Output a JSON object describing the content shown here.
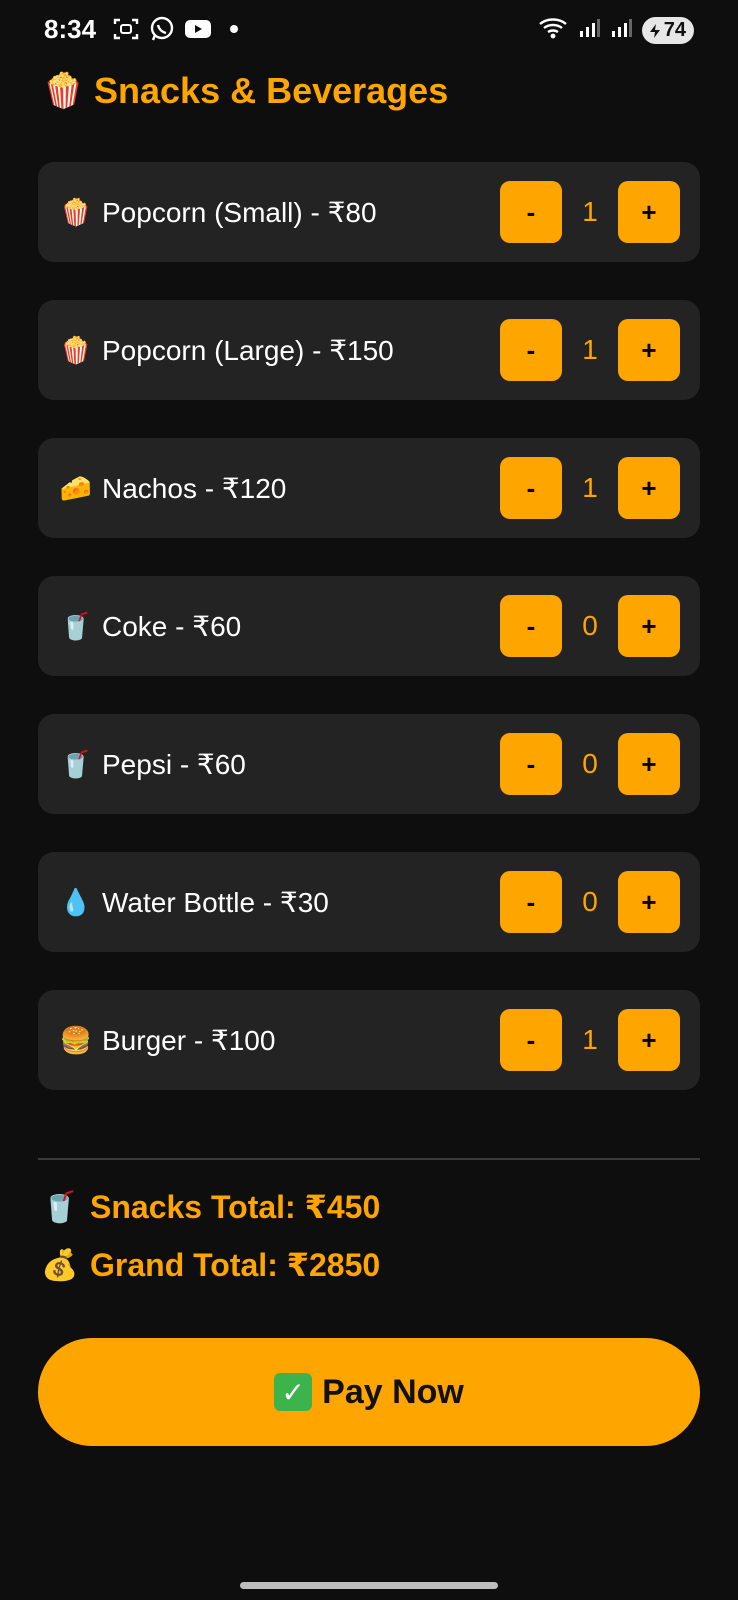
{
  "status_bar": {
    "time": "8:34",
    "battery": "74",
    "icons": [
      "screenshot-icon",
      "whatsapp-icon",
      "youtube-icon",
      "dot-icon",
      "wifi-icon",
      "signal-icon",
      "signal-icon",
      "battery-icon"
    ]
  },
  "header": {
    "emoji": "🍿",
    "title": "Snacks & Beverages"
  },
  "items": [
    {
      "emoji": "🍿",
      "label": "Popcorn (Small) - ₹80",
      "minus": "-",
      "qty": "1",
      "plus": "+"
    },
    {
      "emoji": "🍿",
      "label": "Popcorn (Large) - ₹150",
      "minus": "-",
      "qty": "1",
      "plus": "+"
    },
    {
      "emoji": "🧀",
      "label": "Nachos - ₹120",
      "minus": "-",
      "qty": "1",
      "plus": "+"
    },
    {
      "emoji": "🥤",
      "label": "Coke - ₹60",
      "minus": "-",
      "qty": "0",
      "plus": "+"
    },
    {
      "emoji": "🥤",
      "label": "Pepsi - ₹60",
      "minus": "-",
      "qty": "0",
      "plus": "+"
    },
    {
      "emoji": "💧",
      "label": "Water Bottle - ₹30",
      "minus": "-",
      "qty": "0",
      "plus": "+"
    },
    {
      "emoji": "🍔",
      "label": "Burger - ₹100",
      "minus": "-",
      "qty": "1",
      "plus": "+"
    }
  ],
  "totals": {
    "snacks_emoji": "🥤",
    "snacks_total": "Snacks Total: ₹450",
    "grand_emoji": "💰",
    "grand_total": "Grand Total: ₹2850"
  },
  "pay_button": {
    "icon": "✓",
    "label": "Pay Now"
  },
  "colors": {
    "accent": "#ffa500",
    "background": "#0e0e0e",
    "card": "#232323"
  }
}
